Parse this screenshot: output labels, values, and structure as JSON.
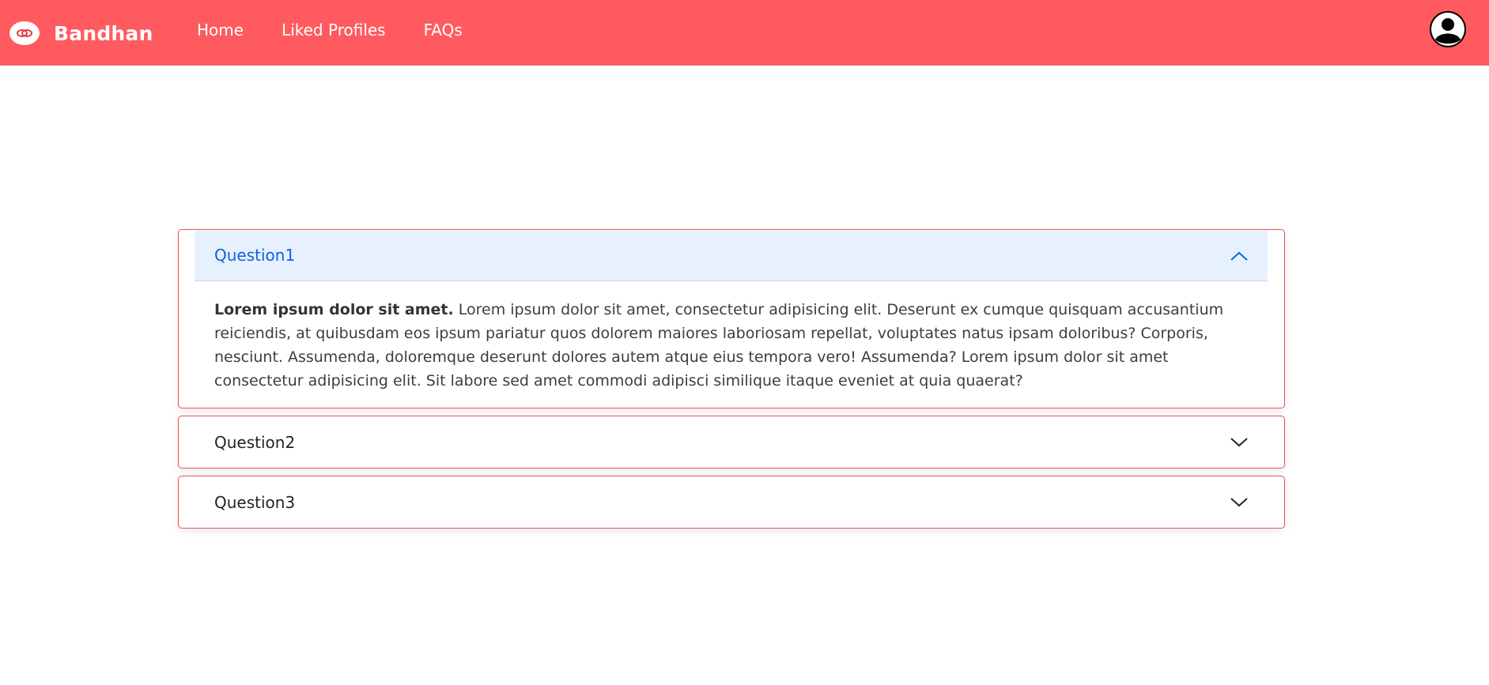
{
  "navbar": {
    "brand": "Bandhan",
    "links": [
      "Home",
      "Liked Profiles",
      "FAQs"
    ],
    "logo_icon": "rings-icon",
    "avatar_icon": "user-avatar-icon",
    "color": "#ff5a5f"
  },
  "faq": {
    "items": [
      {
        "question": "Question1",
        "expanded": true,
        "answer_lead": "Lorem ipsum dolor sit amet.",
        "answer_text": " Lorem ipsum dolor sit amet, consectetur adipisicing elit. Deserunt ex cumque quisquam accusantium reiciendis, at quibusdam eos ipsum pariatur quos dolorem maiores laboriosam repellat, voluptates natus ipsam doloribus? Corporis, nesciunt. Assumenda, doloremque deserunt dolores autem atque eius tempora vero! Assumenda? Lorem ipsum dolor sit amet consectetur adipisicing elit. Sit labore sed amet commodi adipisci similique itaque eveniet at quia quaerat?"
      },
      {
        "question": "Question2",
        "expanded": false
      },
      {
        "question": "Question3",
        "expanded": false
      }
    ],
    "border_color": "#ef4f55",
    "active_header_bg": "#e7f0fd",
    "active_text_color": "#0c63e4"
  }
}
